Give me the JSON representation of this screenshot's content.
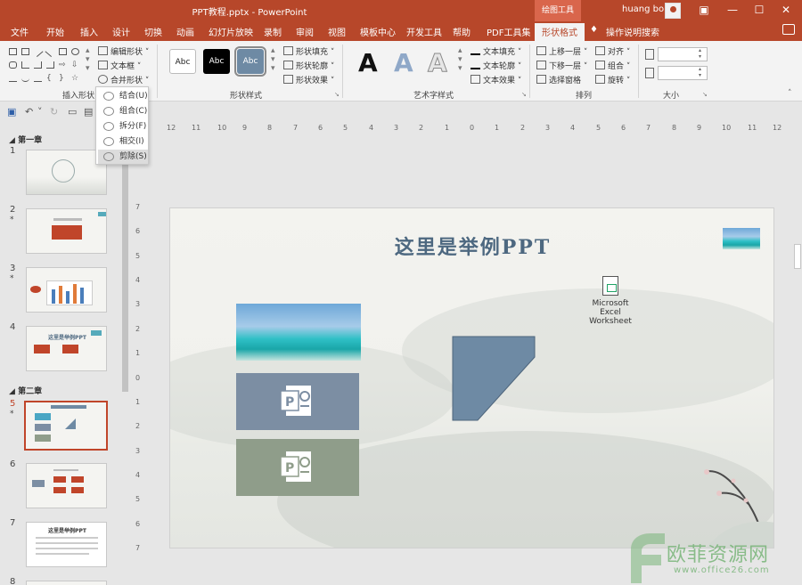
{
  "titlebar": {
    "title": "PPT教程.pptx  -  PowerPoint",
    "context_tab_header": "绘图工具",
    "user": "huang bo"
  },
  "menu": {
    "tabs": [
      "文件",
      "开始",
      "插入",
      "设计",
      "切换",
      "动画",
      "幻灯片放映",
      "录制",
      "审阅",
      "视图",
      "模板中心",
      "开发工具",
      "帮助",
      "PDF工具集",
      "形状格式"
    ],
    "active": "形状格式",
    "search": "操作说明搜索"
  },
  "ribbon": {
    "insert_shapes": {
      "label": "插入形状",
      "edit_shape": "编辑形状",
      "text_box": "文本框",
      "merge_shapes": "合并形状"
    },
    "shape_styles": {
      "label": "形状样式",
      "swatch_text": "Abc",
      "fill": "形状填充",
      "outline": "形状轮廓",
      "effects": "形状效果"
    },
    "wordart": {
      "label": "艺术字样式",
      "glyph": "A",
      "text_fill": "文本填充",
      "text_outline": "文本轮廓",
      "text_effects": "文本效果"
    },
    "arrange": {
      "label": "排列",
      "bring_forward": "上移一层",
      "send_backward": "下移一层",
      "selection_pane": "选择窗格",
      "align": "对齐",
      "group": "组合",
      "rotate": "旋转"
    },
    "size": {
      "label": "大小"
    }
  },
  "merge_dropdown": {
    "items": [
      "结合(U)",
      "组合(C)",
      "拆分(F)",
      "相交(I)",
      "剪除(S)"
    ],
    "hovered": "剪除(S)"
  },
  "sidebar": {
    "section1": "第一章",
    "section2": "第二章",
    "slides": [
      {
        "num": "1",
        "star": ""
      },
      {
        "num": "2",
        "star": "*"
      },
      {
        "num": "3",
        "star": "*"
      },
      {
        "num": "4",
        "star": ""
      },
      {
        "num": "5",
        "star": "*"
      },
      {
        "num": "6",
        "star": ""
      },
      {
        "num": "7",
        "star": ""
      },
      {
        "num": "8",
        "star": ""
      }
    ],
    "thumb_text": {
      "s4": "这里是举例PPT",
      "s7": "这里是举例PPT"
    }
  },
  "ruler": {
    "h": [
      "12",
      "11",
      "10",
      "9",
      "8",
      "7",
      "6",
      "5",
      "4",
      "3",
      "2",
      "1",
      "0",
      "1",
      "2",
      "3",
      "4",
      "5",
      "6",
      "7",
      "8",
      "9",
      "10",
      "11",
      "12"
    ],
    "v": [
      "7",
      "6",
      "5",
      "4",
      "3",
      "2",
      "1",
      "0",
      "1",
      "2",
      "3",
      "4",
      "5",
      "6",
      "7"
    ]
  },
  "slide": {
    "title": "这里是举例PPT",
    "excel_line1": "Microsoft Excel",
    "excel_line2": "Worksheet",
    "shape_color": "#6e8aa4",
    "card_color_top": "#7c8ea3",
    "card_color_bottom": "#8f9d8a"
  },
  "watermark": {
    "text": "欧菲资源网",
    "url": "www.office26.com"
  }
}
